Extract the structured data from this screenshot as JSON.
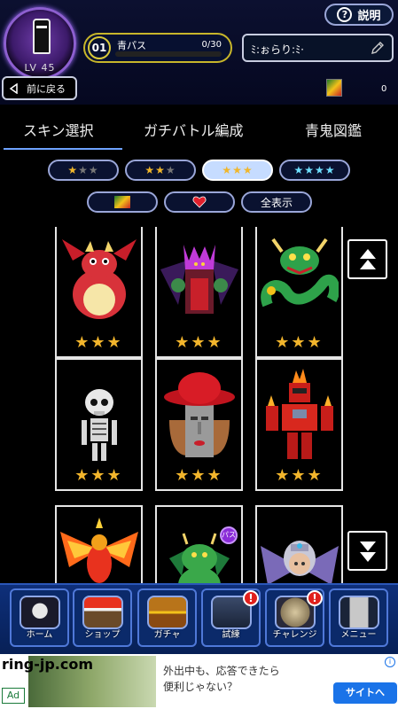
{
  "player": {
    "level": "LV 45",
    "name": "ﾐ:ぉらり:ﾐ·"
  },
  "help": {
    "label": "説明",
    "icon": "?"
  },
  "pass": {
    "number": "01",
    "name": "青パス",
    "progress_text": "0/30",
    "progress": 0
  },
  "back": {
    "label": "前に戻る"
  },
  "ticket": {
    "count": "0"
  },
  "tabs": [
    {
      "label": "スキン選択",
      "active": true
    },
    {
      "label": "ガチバトル編成",
      "active": false
    },
    {
      "label": "青鬼図鑑",
      "active": false
    }
  ],
  "rarity_filters": [
    {
      "stars": "★★★",
      "lit": 1,
      "active": false
    },
    {
      "stars": "★★★",
      "lit": 2,
      "active": false
    },
    {
      "stars": "★★★",
      "lit": 3,
      "active": true
    },
    {
      "stars": "★★★★",
      "lit": 4,
      "active": false
    }
  ],
  "category_filters": [
    {
      "icon": "ticket-icon"
    },
    {
      "icon": "heart-icon"
    },
    {
      "label": "全表示"
    }
  ],
  "skins": [
    {
      "name": "red-dragon",
      "stars": "★★★"
    },
    {
      "name": "purple-demon",
      "stars": "★★★"
    },
    {
      "name": "green-dragon",
      "stars": "★★★"
    },
    {
      "name": "skeleton",
      "stars": "★★★"
    },
    {
      "name": "moai-hat",
      "stars": "★★★"
    },
    {
      "name": "fire-robot",
      "stars": "★★★"
    },
    {
      "name": "phoenix",
      "stars": ""
    },
    {
      "name": "green-dragon-baby",
      "stars": "",
      "badge": "パス"
    },
    {
      "name": "winged-knight",
      "stars": ""
    }
  ],
  "nav": [
    {
      "label": "ホーム",
      "icon": "home-icon",
      "alert": false
    },
    {
      "label": "ショップ",
      "icon": "shop-icon",
      "alert": false
    },
    {
      "label": "ガチャ",
      "icon": "treasure-chest-icon",
      "alert": false
    },
    {
      "label": "試練",
      "icon": "castle-icon",
      "alert": true
    },
    {
      "label": "チャレンジ",
      "icon": "medal-icon",
      "alert": true
    },
    {
      "label": "メニュー",
      "icon": "menu-icon",
      "alert": false
    }
  ],
  "alert_mark": "!",
  "ad": {
    "domain": "ring-jp.com",
    "label": "Ad",
    "headline": "外出中も、応答できたら\n便利じゃない？",
    "cta": "サイトへ"
  },
  "colors": {
    "background": "#000000",
    "accent": "#6ea2ff",
    "star": "#f2b52c",
    "nav": "#0e2f7a"
  }
}
